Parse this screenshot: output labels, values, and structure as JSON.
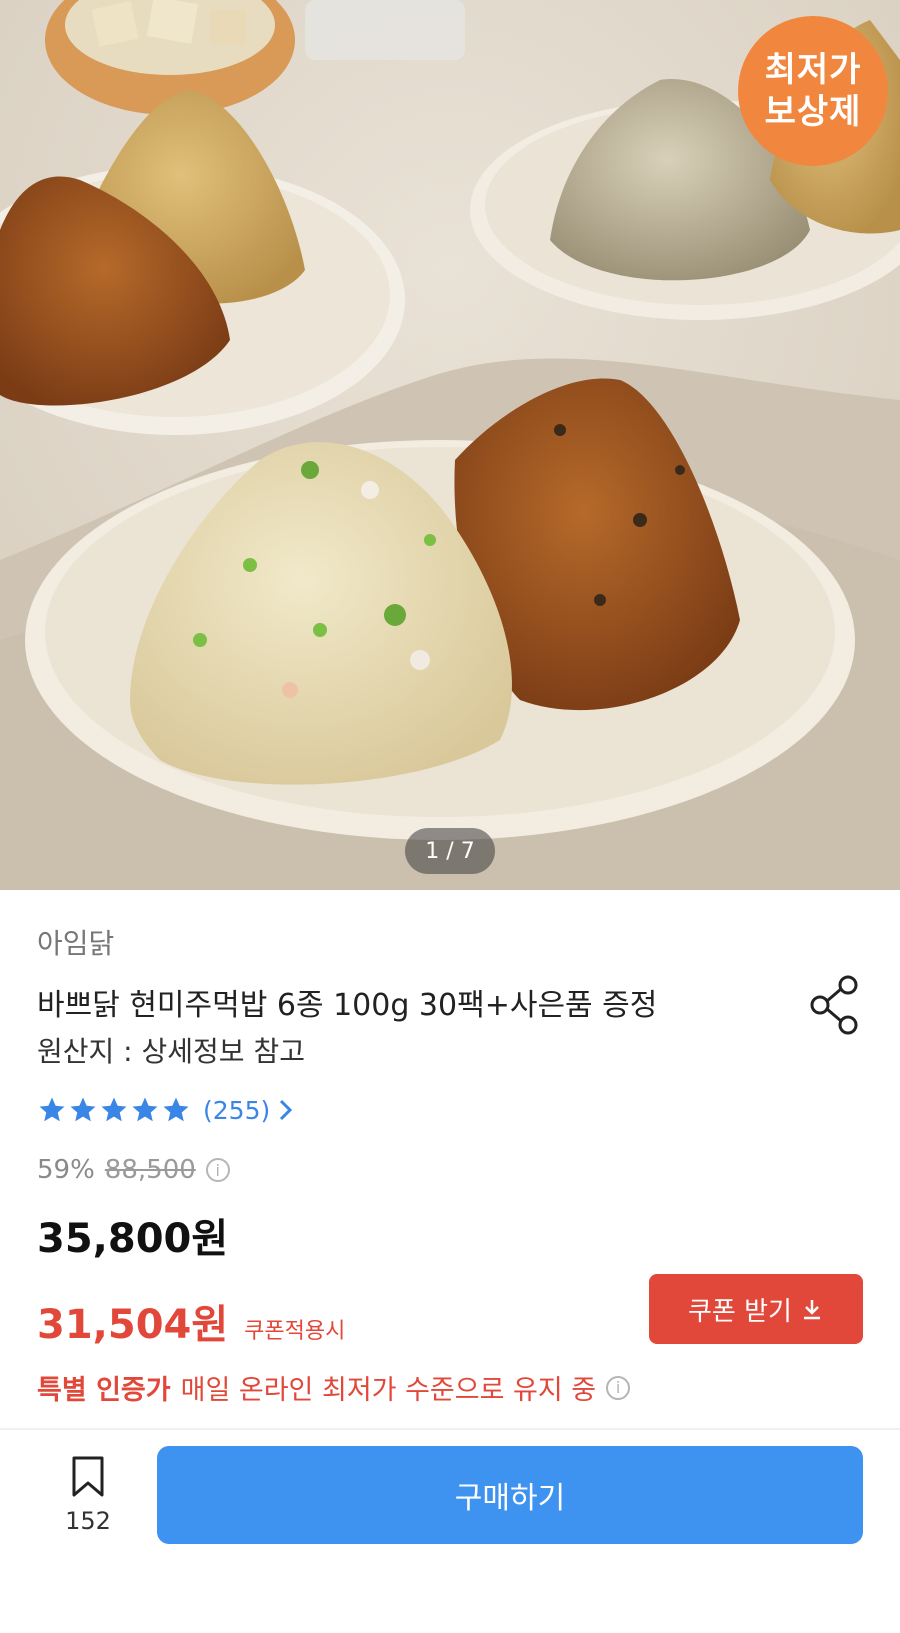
{
  "hero": {
    "badge_line1": "최저가",
    "badge_line2": "보상제",
    "pager": "1 / 7",
    "badge_color": "#f1873e"
  },
  "product": {
    "brand": "아임닭",
    "title": "바쁘닭 현미주먹밥 6종 100g 30팩+사은품 증정",
    "origin": "원산지 : 상세정보 참고",
    "rating_stars": 5,
    "rating_count": "(255)",
    "discount_rate": "59%",
    "original_price": "88,500",
    "price": "35,800원",
    "coupon_price": "31,504원",
    "coupon_note": "쿠폰적용시",
    "coupon_button": "쿠폰 받기",
    "special_label": "특별 인증가",
    "special_message": "매일 온라인 최저가 수준으로 유지 중"
  },
  "bottom_bar": {
    "bookmark_count": "152",
    "buy_button": "구매하기"
  },
  "colors": {
    "accent_red": "#e2483a",
    "accent_blue": "#3e92f0",
    "star_blue": "#3a86e6"
  },
  "icons": [
    "share-icon",
    "star-icon",
    "chevron-right-icon",
    "info-icon",
    "download-icon",
    "bookmark-icon"
  ]
}
